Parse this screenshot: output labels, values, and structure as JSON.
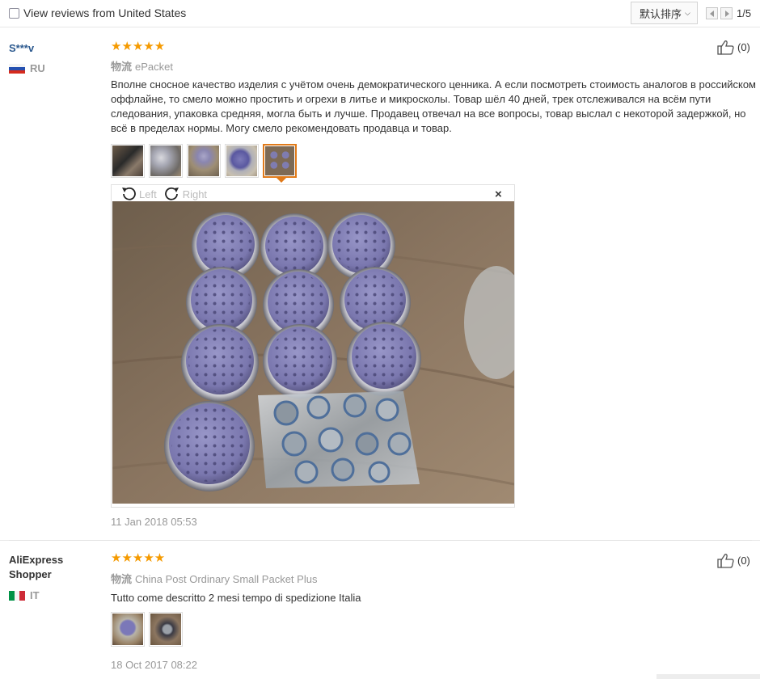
{
  "filter": {
    "label": "View reviews from United States",
    "checked": false
  },
  "sort": {
    "label": "默认排序"
  },
  "pager": {
    "text": "1/5"
  },
  "reviews": [
    {
      "user": "S***v",
      "country": "RU",
      "rating": 5,
      "stars": "★★★★★",
      "logistics_label": "物流",
      "logistics": "ePacket",
      "likes": "(0)",
      "text": "Вполне сносное качество изделия с учётом очень демократического ценника. А если посмотреть стоимость аналогов в российском оффлайне, то смело можно простить и огрехи в литье и микросколы. Товар шёл 40 дней, трек отслеживался на всём пути следования, упаковка средняя, могла быть и лучше. Продавец отвечал на все вопросы, товар выслал с некоторой задержкой, но всё в пределах нормы. Могу смело рекомендовать продавца и товар.",
      "thumb_count": 5,
      "active_thumb": 5,
      "viewer": {
        "left_label": "Left",
        "right_label": "Right",
        "close": "×"
      },
      "date": "11 Jan 2018 05:53"
    },
    {
      "user": "AliExpress Shopper",
      "country": "IT",
      "rating": 5,
      "stars": "★★★★★",
      "logistics_label": "物流",
      "logistics": "China Post Ordinary Small Packet Plus",
      "likes": "(0)",
      "text": "Tutto come descritto 2 mesi tempo di spedizione Italia",
      "thumb_count": 2,
      "date": "18 Oct 2017 08:22"
    }
  ],
  "colors": {
    "star": "#f59a00",
    "active_thumb": "#e07a1a",
    "muted": "#999999",
    "username_link": "#2d5a8f"
  }
}
